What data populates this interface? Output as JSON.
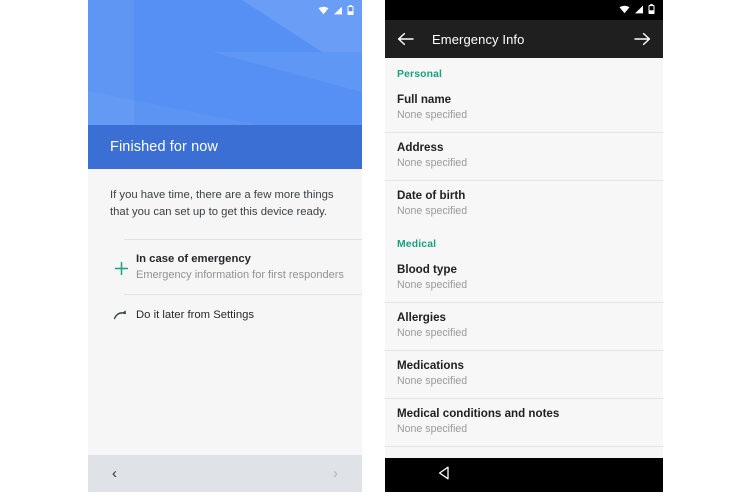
{
  "left_phone": {
    "status_bar": {
      "icons": [
        "wifi-icon",
        "signal-icon",
        "battery-icon"
      ]
    },
    "hero": {
      "banner_title": "Finished for now",
      "background_color": "#5690f4",
      "banner_color": "#3b6fd4"
    },
    "intro_text": "If you have time, there are a few more things that you can set up to get this device ready.",
    "options": [
      {
        "icon": "plus-icon",
        "title": "In case of emergency",
        "subtitle": "Emergency information for first responders",
        "accent_color": "#1aa181"
      },
      {
        "icon": "do-later-arrow-icon",
        "title": "Do it later from Settings",
        "subtitle": ""
      }
    ],
    "nav_bar": {
      "back_label": "‹",
      "forward_label": "›",
      "background_color": "#dfe2e6"
    }
  },
  "right_phone": {
    "status_bar": {
      "icons": [
        "wifi-icon",
        "signal-icon",
        "battery-icon"
      ]
    },
    "toolbar": {
      "title": "Emergency Info",
      "back_icon": "arrow-left-icon",
      "forward_icon": "arrow-right-icon",
      "background_color": "#1f1f1f"
    },
    "accent_color": "#1aa181",
    "sections": [
      {
        "header": "Personal",
        "items": [
          {
            "title": "Full name",
            "value": "None specified"
          },
          {
            "title": "Address",
            "value": "None specified"
          },
          {
            "title": "Date of birth",
            "value": "None specified"
          }
        ]
      },
      {
        "header": "Medical",
        "items": [
          {
            "title": "Blood type",
            "value": "None specified"
          },
          {
            "title": "Allergies",
            "value": "None specified"
          },
          {
            "title": "Medications",
            "value": "None specified"
          },
          {
            "title": "Medical conditions and notes",
            "value": "None specified"
          }
        ]
      }
    ],
    "nav_bar": {
      "back_icon": "nav-back-triangle-icon",
      "background_color": "#000000"
    }
  }
}
